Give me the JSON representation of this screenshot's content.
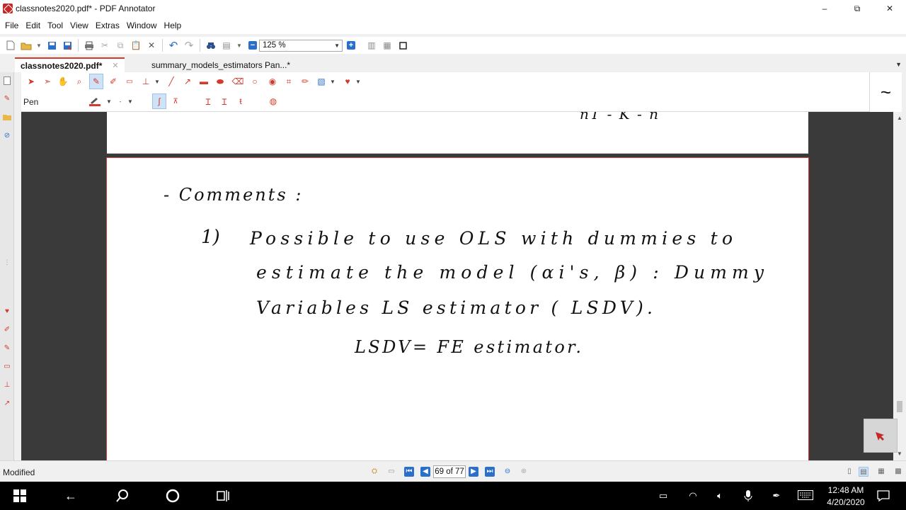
{
  "window": {
    "title": "classnotes2020.pdf* - PDF Annotator",
    "minimize": "‒",
    "maximize": "⧉",
    "close": "✕"
  },
  "menu": [
    "File",
    "Edit",
    "Tool",
    "View",
    "Extras",
    "Window",
    "Help"
  ],
  "toolbar": {
    "zoom_value": "125 %"
  },
  "tabs": [
    {
      "label": "classnotes2020.pdf*",
      "active": true
    },
    {
      "label": "summary_models_estimators Pan...*",
      "active": false
    }
  ],
  "annotation": {
    "current_tool": "Pen",
    "wave": "~"
  },
  "document": {
    "prev_page_text": "nT - K - n",
    "line1": "-  Comments :",
    "item_number": "1)",
    "line2": "Possible to use OLS with dummies to",
    "line3": "estimate the model (αi's, β) : Dummy",
    "line4": "Variables LS estimator ( LSDV).",
    "line5": "LSDV= FE estimator."
  },
  "statusbar": {
    "status": "Modified",
    "page_indicator": "69 of 77"
  },
  "taskbar": {
    "time": "12:48 AM",
    "date": "4/20/2020"
  },
  "colors": {
    "accent_red": "#d23a2e",
    "accent_blue": "#2a6fc9",
    "selected_bg": "#cfe2f6"
  }
}
